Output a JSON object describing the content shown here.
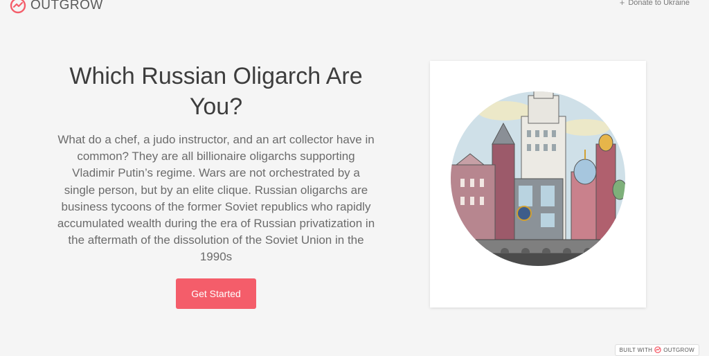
{
  "brand": {
    "name": "OUTGROW",
    "logo_icon": "outgrow-logo-icon",
    "accent": "#f45d6a"
  },
  "header": {
    "donate_label": "Donate to Ukraine",
    "donate_icon": "plus-icon"
  },
  "hero": {
    "title": "Which Russian Oligarch Are You?",
    "description": "What do a chef, a judo instructor, and an art collector have in common? They are all billionaire oligarchs supporting Vladimir Putin’s regime. Wars are not orchestrated by a single person, but by an elite clique. Russian oligarchs are business tycoons of the former Soviet republics who rapidly accumulated wealth during the era of Russian privatization in the aftermath of the dissolution of the Soviet Union in the 1990s",
    "cta_label": "Get Started"
  },
  "illustration": {
    "subject": "moscow-skyline-illustration"
  },
  "footer": {
    "built_with_label": "BUILT WITH",
    "built_with_brand": "OUTGROW"
  }
}
